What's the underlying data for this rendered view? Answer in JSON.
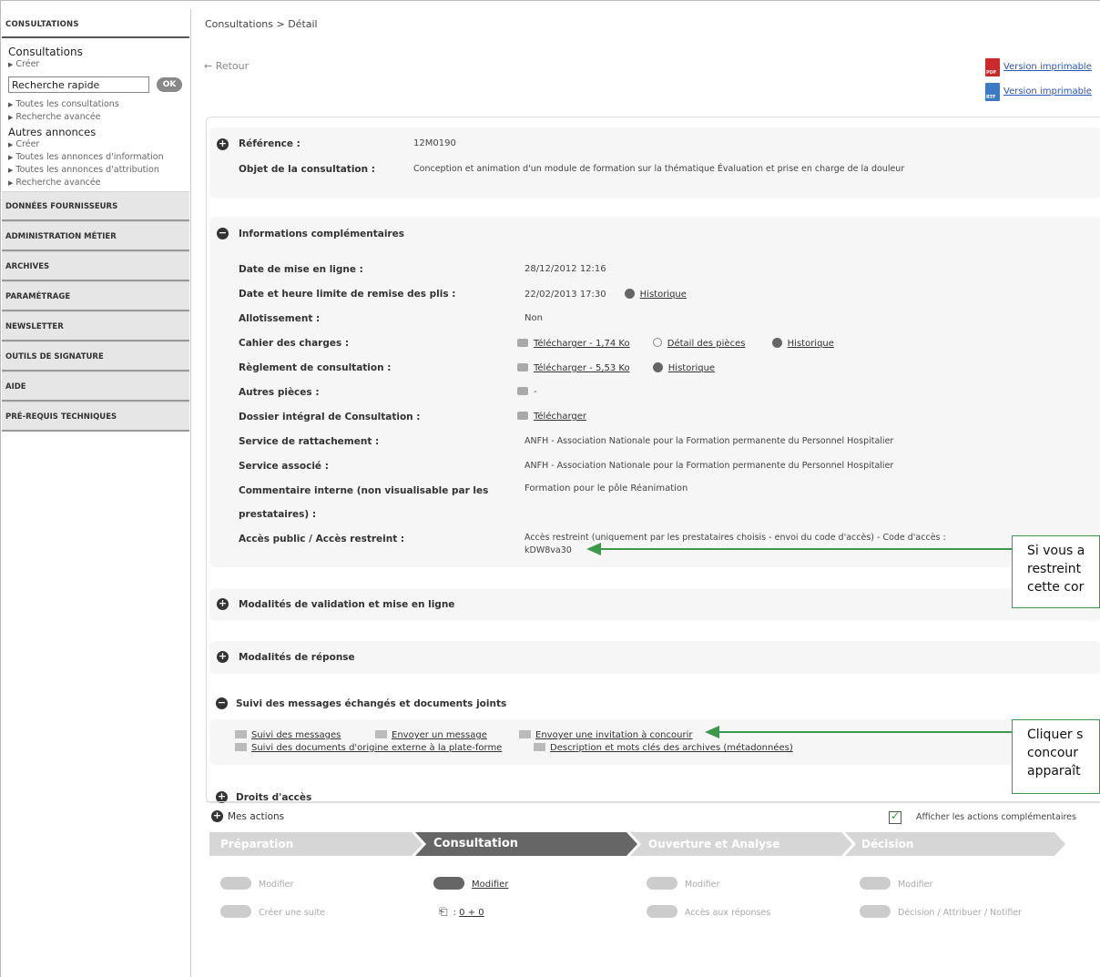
{
  "sidebar": {
    "header": "CONSULTATIONS",
    "consultations_title": "Consultations",
    "creer_1": "Créer",
    "quick_search_value": "Recherche rapide",
    "ok_label": "OK",
    "toutes_consultations": "Toutes les consultations",
    "recherche_avancee_1": "Recherche avancée",
    "autres_annonces_title": "Autres annonces",
    "creer_2": "Créer",
    "annonces_information": "Toutes les annonces d'information",
    "annonces_attribution": "Toutes les annonces d'attribution",
    "recherche_avancee_2": "Recherche avancée",
    "menus": [
      "DONNÉES FOURNISSEURS",
      "ADMINISTRATION MÉTIER",
      "ARCHIVES",
      "PARAMÉTRAGE",
      "NEWSLETTER",
      "OUTILS DE SIGNATURE",
      "AIDE",
      "PRÉ-REQUIS TECHNIQUES"
    ]
  },
  "breadcrumb": "Consultations > Détail",
  "back_label": "Retour",
  "print": {
    "pdf_label": "Version imprimable",
    "pdf_icon_text": "PDF",
    "rtf_label": "Version imprimable",
    "rtf_icon_text": "RTF"
  },
  "reference": {
    "ref_label": "Référence :",
    "ref_value": "12M0190",
    "objet_label": "Objet de la consultation :",
    "objet_value": "Conception et animation d'un module de formation sur la thématique Évaluation et prise en charge de la douleur"
  },
  "info": {
    "title": "Informations complémentaires",
    "date_mise_label": "Date de mise en ligne :",
    "date_mise_value": "28/12/2012 12:16",
    "date_limite_label": "Date et heure limite de remise des plis :",
    "date_limite_value": "22/02/2013 17:30",
    "historique": "Historique",
    "allot_label": "Allotissement :",
    "allot_value": "Non",
    "cahier_label": "Cahier des charges :",
    "cahier_dl": "Télécharger - 1,74 Ko",
    "detail_pieces": "Détail des pièces",
    "reglement_label": "Règlement de consultation :",
    "reglement_dl": "Télécharger - 5,53 Ko",
    "autres_label": "Autres pièces :",
    "autres_value": "-",
    "dossier_label": "Dossier intégral de Consultation :",
    "dossier_dl": "Télécharger",
    "service_ratt_label": "Service de rattachement :",
    "service_ratt_value": "ANFH - Association Nationale pour la Formation permanente du Personnel Hospitalier",
    "service_assoc_label": "Service associé :",
    "service_assoc_value": "ANFH - Association Nationale pour la Formation permanente du Personnel Hospitalier",
    "commentaire_label_1": "Commentaire interne (non visualisable par les",
    "commentaire_label_2": "prestataires) :",
    "commentaire_value": "Formation pour le pôle Réanimation",
    "acces_label": "Accès public / Accès restreint :",
    "acces_value_1": "Accès restreint (uniquement par les prestataires choisis - envoi du code d'accès) - Code d'accès :",
    "acces_value_2": "kDW8va30"
  },
  "sections": {
    "validation": "Modalités de validation et mise en ligne",
    "reponse": "Modalités de réponse",
    "suivi": "Suivi des messages échangés et documents joints",
    "droits": "Droits d'accès"
  },
  "suivi": {
    "suivi_messages": "Suivi des messages",
    "envoyer_message": "Envoyer un message",
    "envoyer_invitation": "Envoyer une invitation à concourir",
    "suivi_documents": "Suivi des documents d'origine externe à la plate-forme",
    "description": "Description et mots clés des archives (métadonnées)"
  },
  "callouts": {
    "c1_line1": "Si vous a",
    "c1_line2": "restreint",
    "c1_line3": "cette cor",
    "c2_line1": "Cliquer s",
    "c2_line2": "concour",
    "c2_line3": "apparaît"
  },
  "actions": {
    "title": "Mes actions",
    "afficher": "Afficher les actions complémentaires",
    "steps": [
      "Préparation",
      "Consultation",
      "Ouverture et Analyse",
      "Décision"
    ],
    "prep_modifier": "Modifier",
    "prep_suite": "Créer une suite",
    "cons_modifier": "Modifier",
    "cons_count": "0 + 0",
    "ouv_modifier": "Modifier",
    "ouv_acces": "Accès aux réponses",
    "dec_modifier": "Modifier",
    "dec_decision": "Décision / Attribuer / Notifier"
  },
  "colors": {
    "accent_green": "#3a9a4a",
    "step_active": "#666666",
    "step_inactive": "#d6d6d6"
  }
}
